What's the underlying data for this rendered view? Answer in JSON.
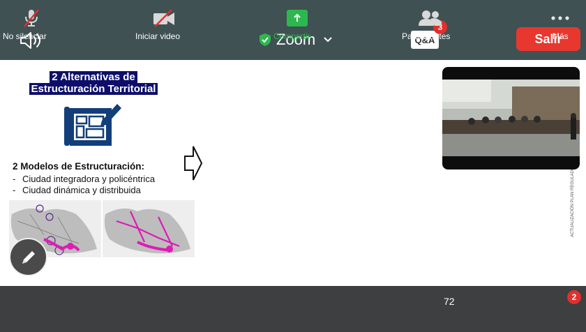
{
  "top_bar": {
    "app_title": "Zoom",
    "qa_label": "Q&A",
    "qa_badge": "3",
    "leave_label": "Salir",
    "accent_green": "#2db84f",
    "leave_color": "#e8372f"
  },
  "slide": {
    "title_line1": "2 Alternativas de",
    "title_line2": "Estructuración Territorial",
    "models_heading": "2 Modelos de Estructuración:",
    "models": [
      "Ciudad integradora y policéntrica",
      "Ciudad dinámica y distribuida"
    ],
    "side_caption": "ACTUALIZACIÓN PLAN REGULADOR"
  },
  "toolbar": {
    "mute_label": "No silenciar",
    "video_label": "Iniciar video",
    "share_label": "Compartir",
    "participants_label": "Participantes",
    "participants_count": "72",
    "more_label": "Más",
    "more_badge": "2"
  },
  "icons": {
    "speaker": "speaker-icon",
    "shield": "shield-check-icon",
    "chevron": "chevron-down-icon",
    "mic": "mic-muted-icon",
    "camera": "camera-off-icon",
    "share": "share-arrow-icon",
    "participants": "participants-icon",
    "more": "more-dots-icon",
    "pen": "pen-icon"
  }
}
